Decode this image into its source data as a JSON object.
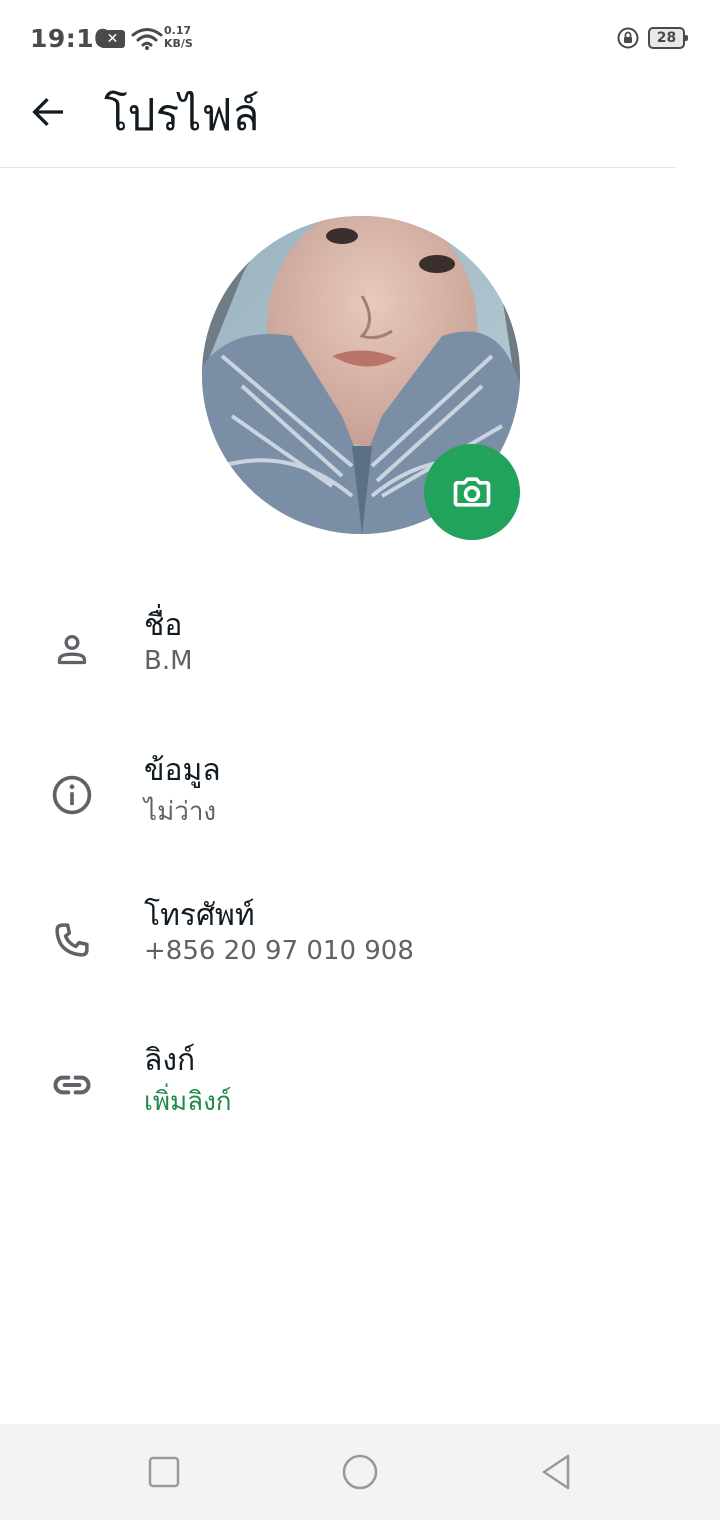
{
  "status_bar": {
    "time": "19:10",
    "notification_glyph": "✕",
    "speed_value": "0.17",
    "speed_unit": "KB/S",
    "battery": "28",
    "icons": [
      "close-notification-icon",
      "wifi-icon",
      "rotation-lock-icon",
      "battery-icon"
    ]
  },
  "app_bar": {
    "title": "โปรไฟล์",
    "back_icon": "arrow-left-icon"
  },
  "profile": {
    "camera_icon": "camera-icon",
    "accent_color": "#21a35b",
    "rows": [
      {
        "icon": "person-icon",
        "label": "ชื่อ",
        "value": "B.M"
      },
      {
        "icon": "info-icon",
        "label": "ข้อมูล",
        "value": "ไม่ว่าง"
      },
      {
        "icon": "phone-icon",
        "label": "โทรศัพท์",
        "value": "+856 20 97 010 908"
      },
      {
        "icon": "link-icon",
        "label": "ลิงก์",
        "value": "เพิ่มลิงก์",
        "value_color": "#1e8a4c"
      }
    ]
  },
  "nav_bar": {
    "buttons": [
      "recent-apps-icon",
      "home-icon",
      "back-triangle-icon"
    ]
  }
}
